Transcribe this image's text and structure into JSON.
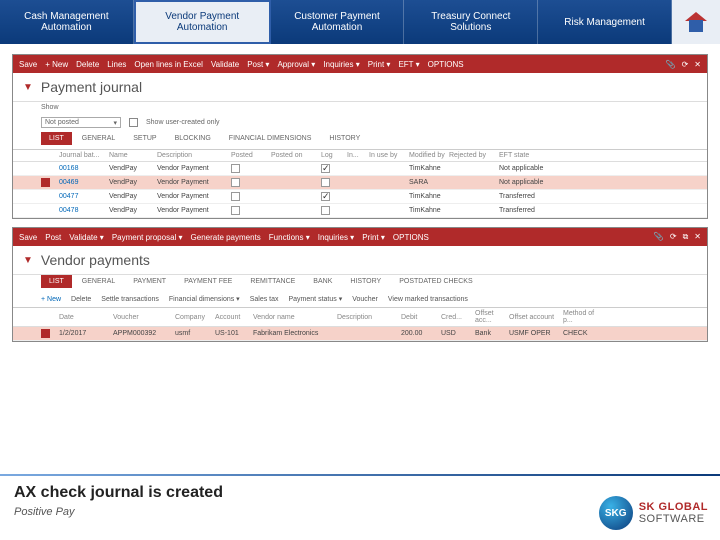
{
  "nav": {
    "tabs": [
      {
        "label": "Cash Management Automation"
      },
      {
        "label": "Vendor Payment Automation"
      },
      {
        "label": "Customer Payment Automation"
      },
      {
        "label": "Treasury Connect Solutions"
      },
      {
        "label": "Risk Management"
      }
    ]
  },
  "ax1": {
    "ribbon": [
      "Save",
      "+ New",
      "Delete",
      "Lines",
      "Open lines in Excel",
      "Validate",
      "Post ▾",
      "Approval ▾",
      "Inquiries ▾",
      "Print ▾",
      "EFT ▾",
      "OPTIONS"
    ],
    "title": "Payment journal",
    "show_label": "Show",
    "show_value": "Not posted",
    "user_only": "Show user-created only",
    "tabs": [
      "LIST",
      "GENERAL",
      "SETUP",
      "BLOCKING",
      "FINANCIAL DIMENSIONS",
      "HISTORY"
    ],
    "cols": [
      "",
      "Journal bat...",
      "Name",
      "Description",
      "Posted",
      "Posted on",
      "Log",
      "In...",
      "In use by",
      "Modified by",
      "Rejected by",
      "EFT state"
    ],
    "rows": [
      {
        "sel": false,
        "batch": "00168",
        "name": "VendPay",
        "desc": "Vendor Payment",
        "posted": false,
        "log": true,
        "mod": "TimKahne",
        "eft": "Not applicable"
      },
      {
        "sel": true,
        "batch": "00469",
        "name": "VendPay",
        "desc": "Vendor Payment",
        "posted": false,
        "log": false,
        "mod": "SARA",
        "eft": "Not applicable"
      },
      {
        "sel": false,
        "batch": "00477",
        "name": "VendPay",
        "desc": "Vendor Payment",
        "posted": false,
        "log": true,
        "mod": "TimKahne",
        "eft": "Transferred"
      },
      {
        "sel": false,
        "batch": "00478",
        "name": "VendPay",
        "desc": "Vendor Payment",
        "posted": false,
        "log": false,
        "mod": "TimKahne",
        "eft": "Transferred"
      }
    ]
  },
  "ax2": {
    "ribbon": [
      "Save",
      "Post",
      "Validate ▾",
      "Payment proposal ▾",
      "Generate payments",
      "Functions ▾",
      "Inquiries ▾",
      "Print ▾",
      "OPTIONS"
    ],
    "title": "Vendor payments",
    "tabs": [
      "LIST",
      "GENERAL",
      "PAYMENT",
      "PAYMENT FEE",
      "REMITTANCE",
      "BANK",
      "HISTORY",
      "POSTDATED CHECKS"
    ],
    "toolbar": [
      "+ New",
      "Delete",
      "Settle transactions",
      "Financial dimensions ▾",
      "Sales tax",
      "Payment status ▾",
      "Voucher",
      "View marked transactions"
    ],
    "cols": [
      "",
      "Date",
      "Voucher",
      "Company",
      "Account",
      "Vendor name",
      "Description",
      "Debit",
      "Cred...",
      "Offset acc...",
      "Offset account",
      "Method of p..."
    ],
    "row": {
      "date": "1/2/2017",
      "voucher": "APPM000392",
      "company": "usmf",
      "account": "US-101",
      "vendor": "Fabrikam Electronics",
      "desc": "",
      "debit": "200.00",
      "cred": "USD",
      "offtype": "Bank",
      "offacct": "USMF OPER",
      "method": "CHECK"
    }
  },
  "footer": {
    "headline": "AX check journal is created",
    "subtitle": "Positive Pay",
    "logo_badge": "SKG",
    "logo_line1": "SK GLOBAL",
    "logo_line2": "SOFTWARE"
  }
}
